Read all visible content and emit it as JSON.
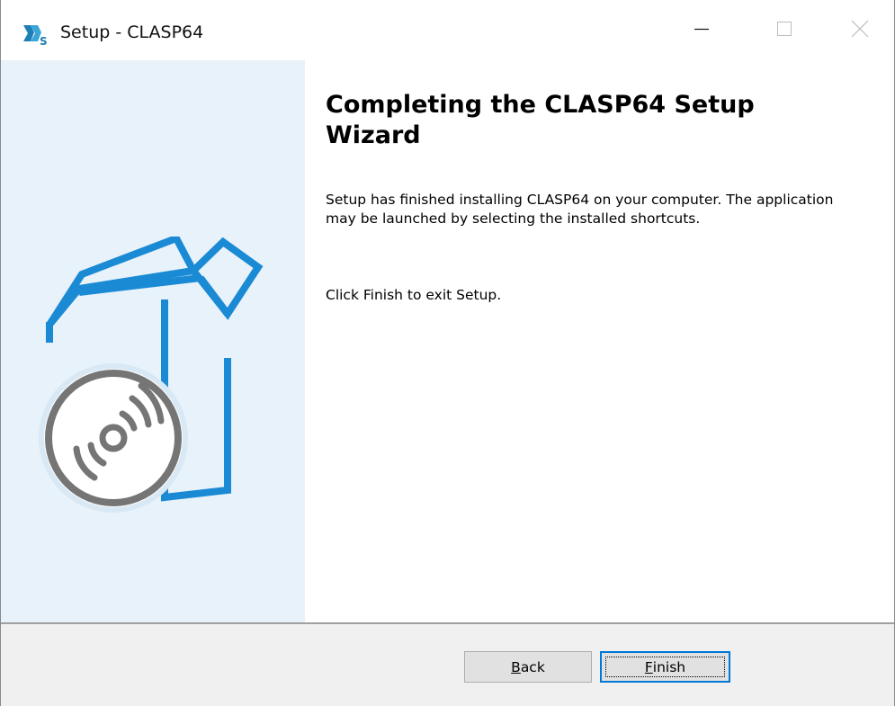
{
  "window": {
    "title": "Setup - CLASP64",
    "icon": "app-logo-icon",
    "controls": [
      "minimize-icon",
      "maximize-icon",
      "close-icon"
    ]
  },
  "content": {
    "heading": "Completing the CLASP64 Setup Wizard",
    "paragraph1": "Setup has finished installing CLASP64 on your computer. The application may be launched by selecting the installed shortcuts.",
    "paragraph2": "Click Finish to exit Setup."
  },
  "buttons": {
    "back": {
      "mnemonic": "B",
      "rest": "ack"
    },
    "finish": {
      "mnemonic": "F",
      "rest": "inish"
    }
  },
  "colors": {
    "banner": "#e8f2fa",
    "accent": "#1a8ad4",
    "disc": "#757575",
    "focus_border": "#0078d7"
  }
}
